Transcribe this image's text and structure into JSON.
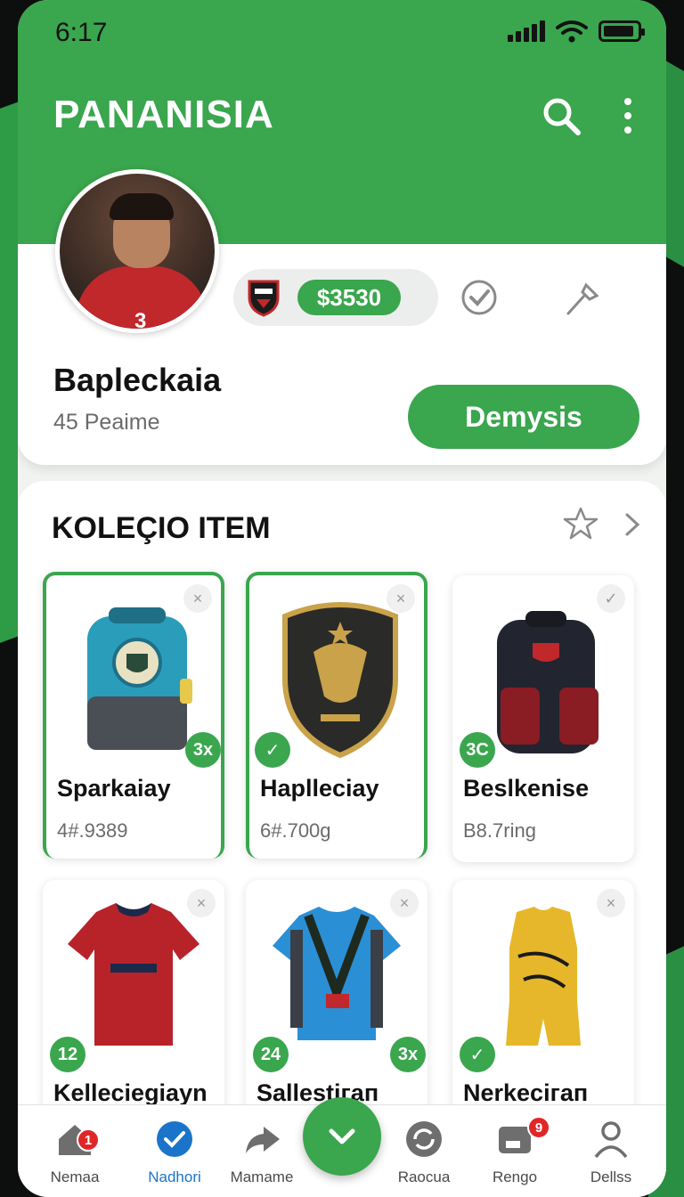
{
  "status_bar": {
    "time": "6:17"
  },
  "app": {
    "title": "PANANISIA"
  },
  "profile": {
    "avatar_number": "3",
    "balance": "$3530",
    "name": "Baplеckaia",
    "subtitle": "45 Peaime",
    "action_label": "Demysis"
  },
  "collection": {
    "title": "KOLEÇIO ITEM",
    "items": [
      {
        "title": "Sparkaiay",
        "meta": "4#.9389",
        "badge": "3x",
        "close": "×"
      },
      {
        "title": "Hapllеciay",
        "meta": "6#.700g",
        "badge": "✓",
        "close": "×"
      },
      {
        "title": "Beslkenise",
        "meta": "B8.7ring",
        "badge": "3C",
        "close": "✓"
      },
      {
        "title": "Kellеciеgiayn",
        "badge": "12",
        "close": "×"
      },
      {
        "title": "Sallestiгап",
        "badge": "24",
        "badge2": "3x",
        "close": "×"
      },
      {
        "title": "Nerkеciгап",
        "badge": "✓",
        "close": "×"
      }
    ]
  },
  "nav": {
    "items": [
      {
        "label": "Nemaa",
        "badge": "1"
      },
      {
        "label": "Nadhori"
      },
      {
        "label": "Mamame"
      },
      {
        "label": "Raocua"
      },
      {
        "label": "Rengo",
        "badge": "9"
      },
      {
        "label": "Dellss"
      }
    ]
  },
  "colors": {
    "accent": "#3aa64e",
    "active_nav": "#1a74c9",
    "notification": "#e02727"
  }
}
